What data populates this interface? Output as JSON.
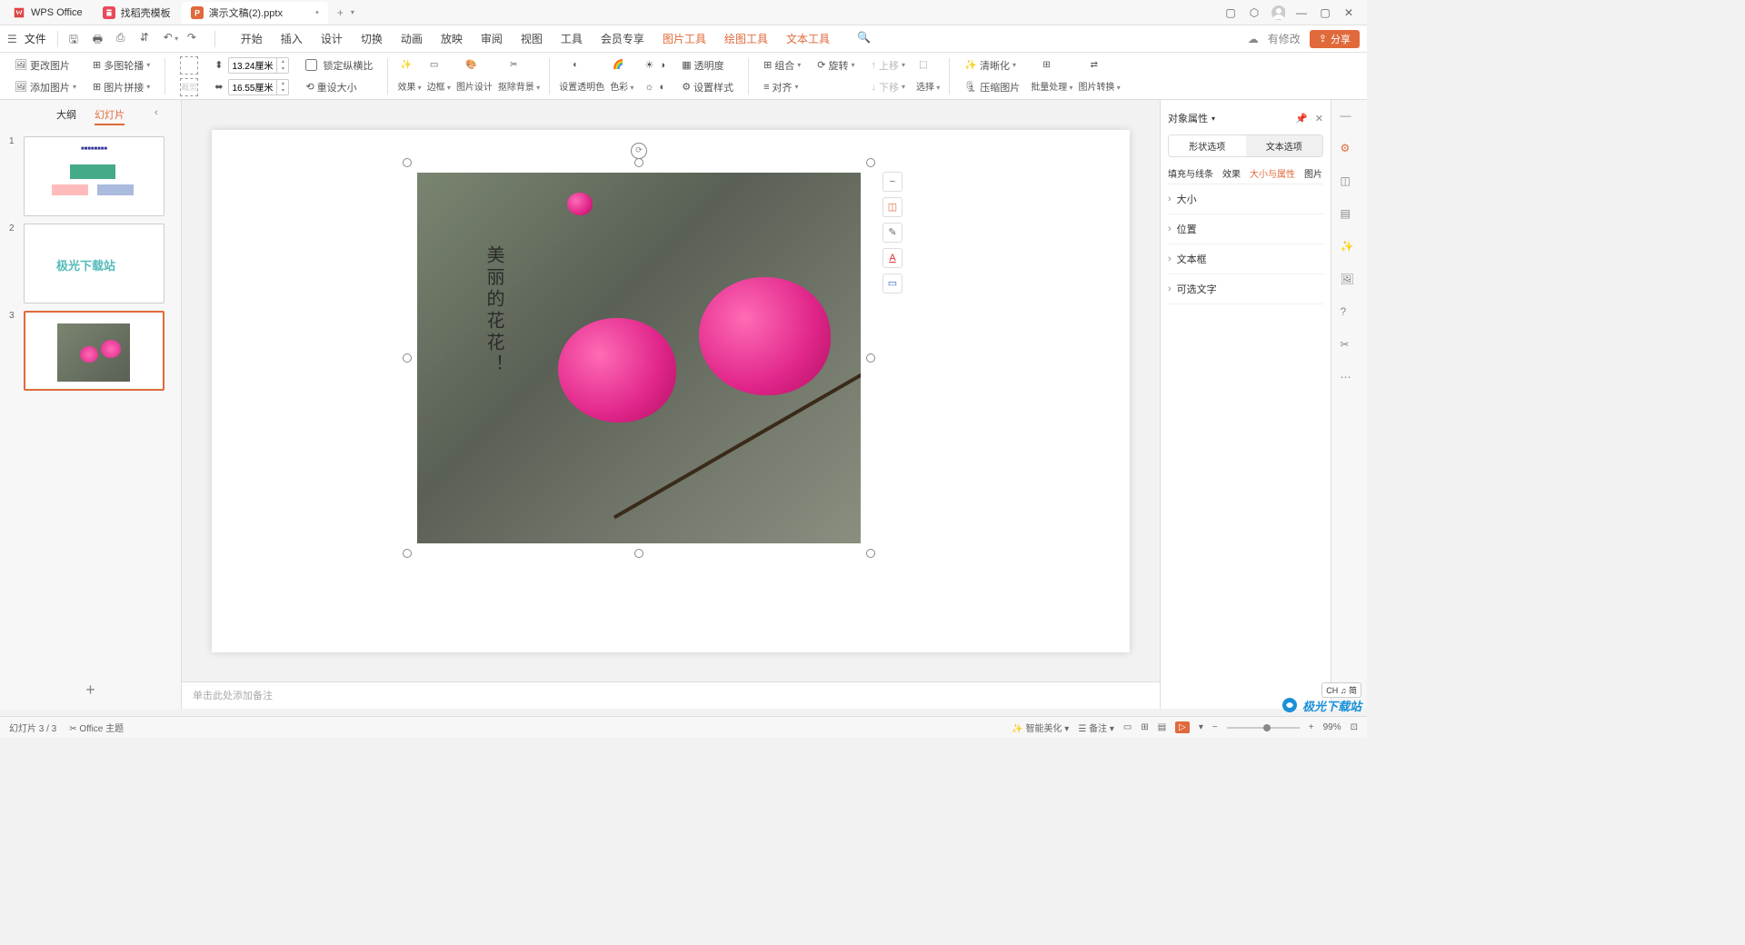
{
  "titlebar": {
    "app": "WPS Office",
    "tab1": "找稻壳模板",
    "tab2": "演示文稿(2).pptx"
  },
  "menu": {
    "file": "文件",
    "tabs": [
      "开始",
      "插入",
      "设计",
      "切换",
      "动画",
      "放映",
      "审阅",
      "视图",
      "工具",
      "会员专享",
      "图片工具",
      "绘图工具",
      "文本工具"
    ],
    "modify": "有修改",
    "share": "分享"
  },
  "ribbon": {
    "change_img": "更改图片",
    "multi_rotate": "多图轮播",
    "add_img": "添加图片",
    "img_join": "图片拼接",
    "crop": "裁剪",
    "width": "13.24厘米",
    "height": "16.55厘米",
    "lock_ratio": "锁定纵横比",
    "reset_size": "重设大小",
    "effect": "效果",
    "border": "边框",
    "img_design": "图片设计",
    "remove_bg": "抠除背景",
    "set_trans": "设置透明色",
    "color": "色彩",
    "trans": "透明度",
    "set_style": "设置样式",
    "combine": "组合",
    "rotate": "旋转",
    "align": "对齐",
    "up": "上移",
    "down": "下移",
    "select": "选择",
    "clarity": "清晰化",
    "compress": "压缩图片",
    "batch": "批量处理",
    "convert": "图片转换"
  },
  "slidepanel": {
    "outline": "大纲",
    "slides": "幻灯片"
  },
  "canvas": {
    "vtext": "美丽的花花！",
    "notes_placeholder": "单击此处添加备注"
  },
  "prop": {
    "title": "对象属性",
    "shape_opt": "形状选项",
    "text_opt": "文本选项",
    "sub": [
      "填充与线条",
      "效果",
      "大小与属性",
      "图片"
    ],
    "sec_size": "大小",
    "sec_pos": "位置",
    "sec_textbox": "文本框",
    "sec_alt": "可选文字"
  },
  "status": {
    "slide": "幻灯片 3 / 3",
    "theme": "Office 主题",
    "smart": "智能美化",
    "notes": "备注",
    "zoom": "99%"
  },
  "watermark": "极光下载站",
  "ch_badge": "CH ♫ 简"
}
